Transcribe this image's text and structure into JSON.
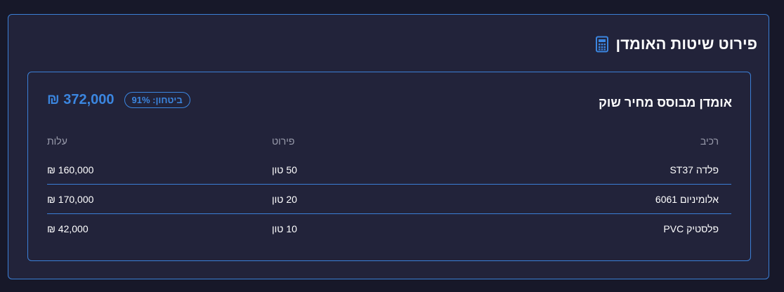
{
  "panel": {
    "title": "פירוט שיטות האומדן",
    "icon": "calculator-icon",
    "accent_color": "#3b86e0"
  },
  "method": {
    "title": "אומדן מבוסס מחיר שוק",
    "total": "372,000 ₪",
    "confidence_badge": "ביטחון: 91%"
  },
  "table": {
    "headers": {
      "component": "רכיב",
      "detail": "פירוט",
      "cost": "עלות"
    },
    "rows": [
      {
        "component": "פלדה ST37",
        "detail": "50 טון",
        "cost": "160,000 ₪"
      },
      {
        "component": "אלומיניום 6061",
        "detail": "20 טון",
        "cost": "170,000 ₪"
      },
      {
        "component": "פלסטיק PVC",
        "detail": "10 טון",
        "cost": "42,000 ₪"
      }
    ]
  }
}
